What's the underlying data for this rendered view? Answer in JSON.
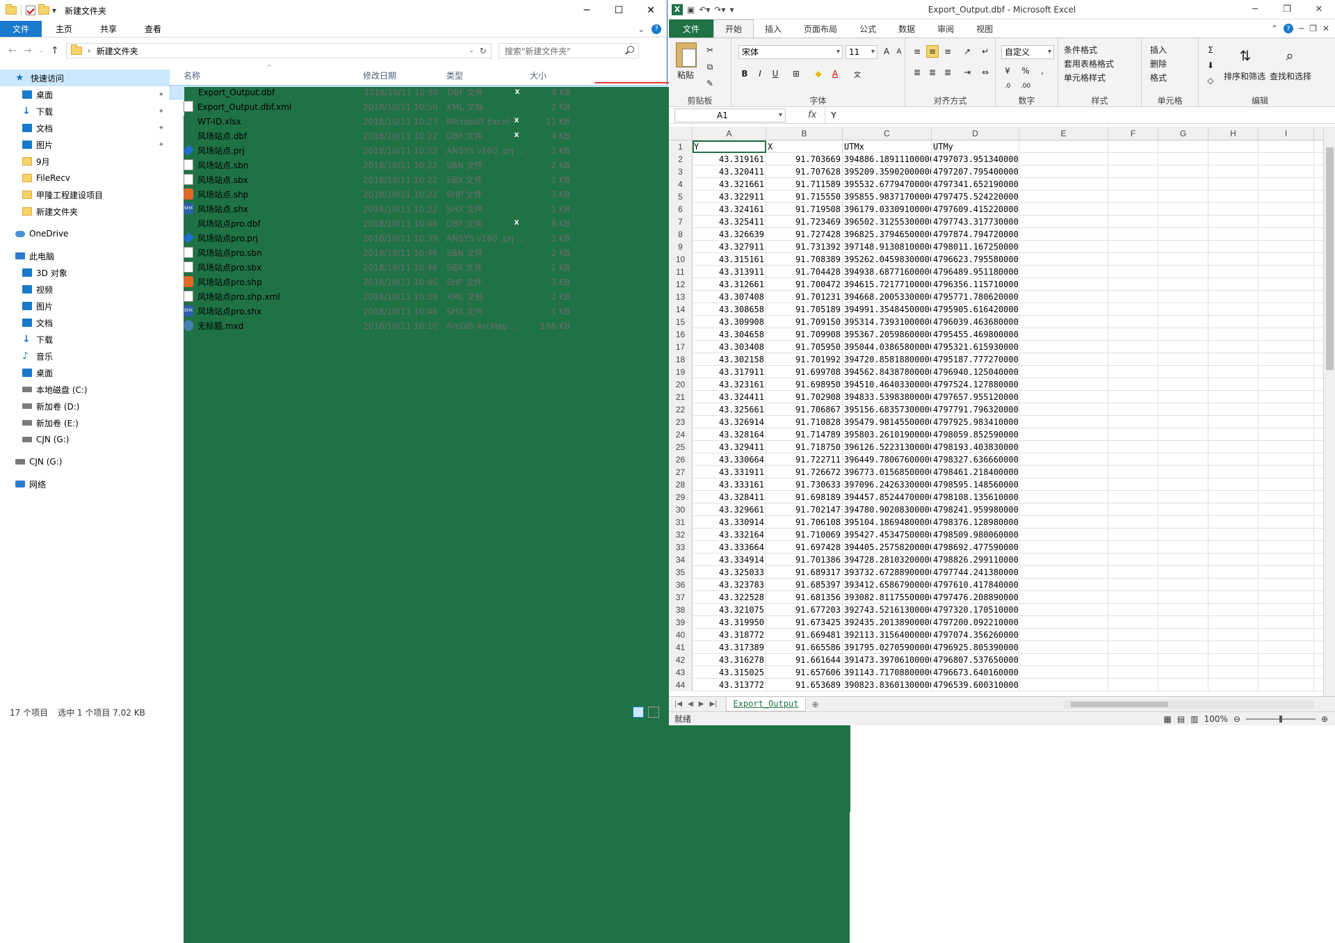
{
  "explorer": {
    "window_title": "新建文件夹",
    "tabs": [
      "文件",
      "主页",
      "共享",
      "查看"
    ],
    "address_path": "新建文件夹",
    "search_placeholder": "搜索\"新建文件夹\"",
    "nav": [
      {
        "label": "快速访问",
        "icon": "star-icon",
        "selected": true,
        "pinned": false
      },
      {
        "label": "桌面",
        "icon": "desktop-icon",
        "pinned": true
      },
      {
        "label": "下载",
        "icon": "download-icon",
        "pinned": true
      },
      {
        "label": "文档",
        "icon": "documents-icon",
        "pinned": true
      },
      {
        "label": "图片",
        "icon": "pictures-icon",
        "pinned": true
      },
      {
        "label": "9月",
        "icon": "folder-icon",
        "pinned": false
      },
      {
        "label": "FileRecv",
        "icon": "folder-icon",
        "pinned": false
      },
      {
        "label": "甲隆工程建设项目",
        "icon": "folder-icon",
        "pinned": false
      },
      {
        "label": "新建文件夹",
        "icon": "folder-icon",
        "pinned": false
      },
      {
        "label": "OneDrive",
        "icon": "cloud-icon",
        "pinned": false
      },
      {
        "label": "此电脑",
        "icon": "computer-icon",
        "pinned": false
      },
      {
        "label": "3D 对象",
        "icon": "3d-objects-icon",
        "pinned": false
      },
      {
        "label": "视频",
        "icon": "video-icon",
        "pinned": false
      },
      {
        "label": "图片",
        "icon": "pictures-icon",
        "pinned": false
      },
      {
        "label": "文档",
        "icon": "documents-icon",
        "pinned": false
      },
      {
        "label": "下载",
        "icon": "download-icon",
        "pinned": false
      },
      {
        "label": "音乐",
        "icon": "music-icon",
        "pinned": false
      },
      {
        "label": "桌面",
        "icon": "desktop-icon",
        "pinned": false
      },
      {
        "label": "本地磁盘 (C:)",
        "icon": "drive-icon",
        "pinned": false
      },
      {
        "label": "新加卷 (D:)",
        "icon": "drive-icon",
        "pinned": false
      },
      {
        "label": "新加卷 (E:)",
        "icon": "drive-icon",
        "pinned": false
      },
      {
        "label": "CJN (G:)",
        "icon": "drive-icon",
        "pinned": false
      },
      {
        "label": "CJN (G:)",
        "icon": "drive-icon",
        "pinned": false
      },
      {
        "label": "网络",
        "icon": "network-icon",
        "pinned": false
      }
    ],
    "columns": {
      "name": "名称",
      "date": "修改日期",
      "type": "类型",
      "size": "大小"
    },
    "files": [
      {
        "name": "Export_Output.dbf",
        "date": "2018/10/11 10:50",
        "type": "DBF 文件",
        "size": "8 KB",
        "icon": "xl",
        "selected": true
      },
      {
        "name": "Export_Output.dbf.xml",
        "date": "2018/10/11 10:50",
        "type": "XML 文档",
        "size": "2 KB",
        "icon": "doc"
      },
      {
        "name": "WT-ID.xlsx",
        "date": "2018/10/11 10:23",
        "type": "Microsoft Excel",
        "size": "11 KB",
        "icon": "xl"
      },
      {
        "name": "风场站点.dbf",
        "date": "2018/10/11 10:22",
        "type": "DBF 文件",
        "size": "4 KB",
        "icon": "xl"
      },
      {
        "name": "风场站点.prj",
        "date": "2018/10/11 10:22",
        "type": "ANSYS v160 .prj ...",
        "size": "1 KB",
        "icon": "prj"
      },
      {
        "name": "风场站点.sbn",
        "date": "2018/10/11 10:22",
        "type": "SBN 文件",
        "size": "2 KB",
        "icon": "doc"
      },
      {
        "name": "风场站点.sbx",
        "date": "2018/10/11 10:22",
        "type": "SBX 文件",
        "size": "1 KB",
        "icon": "doc"
      },
      {
        "name": "风场站点.shp",
        "date": "2018/10/11 10:22",
        "type": "SHP 文件",
        "size": "3 KB",
        "icon": "shp"
      },
      {
        "name": "风场站点.shx",
        "date": "2018/10/11 10:22",
        "type": "SHX 文件",
        "size": "1 KB",
        "icon": "shx"
      },
      {
        "name": "风场站点pro.dbf",
        "date": "2018/10/11 10:46",
        "type": "DBF 文件",
        "size": "8 KB",
        "icon": "xl"
      },
      {
        "name": "风场站点pro.prj",
        "date": "2018/10/11 10:39",
        "type": "ANSYS v160 .prj ...",
        "size": "1 KB",
        "icon": "prj"
      },
      {
        "name": "风场站点pro.sbn",
        "date": "2018/10/11 10:46",
        "type": "SBN 文件",
        "size": "2 KB",
        "icon": "doc"
      },
      {
        "name": "风场站点pro.sbx",
        "date": "2018/10/11 10:46",
        "type": "SBX 文件",
        "size": "1 KB",
        "icon": "doc"
      },
      {
        "name": "风场站点pro.shp",
        "date": "2018/10/11 10:46",
        "type": "SHP 文件",
        "size": "3 KB",
        "icon": "shp"
      },
      {
        "name": "风场站点pro.shp.xml",
        "date": "2018/10/11 10:39",
        "type": "XML 文档",
        "size": "2 KB",
        "icon": "doc"
      },
      {
        "name": "风场站点pro.shx",
        "date": "2018/10/11 10:46",
        "type": "SHX 文件",
        "size": "1 KB",
        "icon": "shx"
      },
      {
        "name": "无标题.mxd",
        "date": "2018/10/11 10:10",
        "type": "ArcGIS ArcMap ...",
        "size": "196 KB",
        "icon": "mxd"
      }
    ],
    "status_count": "17 个项目",
    "status_selected": "选中 1 个项目  7.02 KB"
  },
  "excel": {
    "title": "Export_Output.dbf  -  Microsoft Excel",
    "tabs": [
      "文件",
      "开始",
      "插入",
      "页面布局",
      "公式",
      "数据",
      "审阅",
      "视图"
    ],
    "active_tab": "开始",
    "ribbon": {
      "paste": "粘贴",
      "clipboard": "剪贴板",
      "font_name": "宋体",
      "font_size": "11",
      "font_group": "字体",
      "align_group": "对齐方式",
      "number_format": "自定义",
      "number_group": "数字",
      "cond_format": "条件格式",
      "table_format": "套用表格格式",
      "cell_style": "单元格样式",
      "style_group": "样式",
      "insert": "插入",
      "delete": "删除",
      "format": "格式",
      "cells_group": "单元格",
      "sort_filter": "排序和筛选",
      "find_select": "查找和选择",
      "edit_group": "编辑"
    },
    "namebox": "A1",
    "fx": "fx",
    "formula": "Y",
    "col_letters": [
      "A",
      "B",
      "C",
      "D",
      "E",
      "F",
      "G",
      "H",
      "I"
    ],
    "header_row": [
      "Y",
      "X",
      "UTMx",
      "UTMy"
    ],
    "rows": [
      [
        "43.319161",
        "91.703669",
        "394886.18911100000",
        "4797073.95134000000"
      ],
      [
        "43.320411",
        "91.707628",
        "395209.35902000000",
        "4797207.79540000000"
      ],
      [
        "43.321661",
        "91.711589",
        "395532.67794700000",
        "4797341.65219000000"
      ],
      [
        "43.322911",
        "91.715550",
        "395855.98371700000",
        "4797475.52422000000"
      ],
      [
        "43.324161",
        "91.719508",
        "396179.03309100000",
        "4797609.41522000000"
      ],
      [
        "43.325411",
        "91.723469",
        "396502.31255300000",
        "4797743.31773000000"
      ],
      [
        "43.326639",
        "91.727428",
        "396825.37946500000",
        "4797874.79472000000"
      ],
      [
        "43.327911",
        "91.731392",
        "397148.91308100000",
        "4798011.16725000000"
      ],
      [
        "43.315161",
        "91.708389",
        "395262.04598300000",
        "4796623.79558000000"
      ],
      [
        "43.313911",
        "91.704428",
        "394938.68771600000",
        "4796489.95118000000"
      ],
      [
        "43.312661",
        "91.700472",
        "394615.72177100000",
        "4796356.11571000000"
      ],
      [
        "43.307408",
        "91.701231",
        "394668.20053300000",
        "4795771.78062000000"
      ],
      [
        "43.308658",
        "91.705189",
        "394991.35484500000",
        "4795905.61642000000"
      ],
      [
        "43.309908",
        "91.709150",
        "395314.73931000000",
        "4796039.46368000000"
      ],
      [
        "43.304658",
        "91.709908",
        "395367.20598600000",
        "4795455.46980000000"
      ],
      [
        "43.303408",
        "91.705950",
        "395044.03865800000",
        "4795321.61593000000"
      ],
      [
        "43.302158",
        "91.701992",
        "394720.85818800000",
        "4795187.77727000000"
      ],
      [
        "43.317911",
        "91.699708",
        "394562.84387800000",
        "4796940.12504000000"
      ],
      [
        "43.323161",
        "91.698950",
        "394510.46403300000",
        "4797524.12788000000"
      ],
      [
        "43.324411",
        "91.702908",
        "394833.53983800000",
        "4797657.95512000000"
      ],
      [
        "43.325661",
        "91.706867",
        "395156.68357300000",
        "4797791.79632000000"
      ],
      [
        "43.326914",
        "91.710828",
        "395479.98145500000",
        "4797925.98341000000"
      ],
      [
        "43.328164",
        "91.714789",
        "395803.26101900000",
        "4798059.85259000000"
      ],
      [
        "43.329411",
        "91.718750",
        "396126.52231300000",
        "4798193.40383000000"
      ],
      [
        "43.330664",
        "91.722711",
        "396449.78067600000",
        "4798327.63666000000"
      ],
      [
        "43.331911",
        "91.726672",
        "396773.01568500000",
        "4798461.21840000000"
      ],
      [
        "43.333161",
        "91.730633",
        "397096.24263300000",
        "4798595.14856000000"
      ],
      [
        "43.328411",
        "91.698189",
        "394457.85244700000",
        "4798108.13561000000"
      ],
      [
        "43.329661",
        "91.702147",
        "394780.90208300000",
        "4798241.95998000000"
      ],
      [
        "43.330914",
        "91.706108",
        "395104.18694800000",
        "4798376.12898000000"
      ],
      [
        "43.332164",
        "91.710069",
        "395427.45347500000",
        "4798509.98006000000"
      ],
      [
        "43.333664",
        "91.697428",
        "394405.25758200000",
        "4798692.47759000000"
      ],
      [
        "43.334914",
        "91.701386",
        "394728.28103200000",
        "4798826.29911000000"
      ],
      [
        "43.325033",
        "91.689317",
        "393732.67288900000",
        "4797744.24138000000"
      ],
      [
        "43.323783",
        "91.685397",
        "393412.65867900000",
        "4797610.41784000000"
      ],
      [
        "43.322528",
        "91.681356",
        "393082.81175500000",
        "4797476.20889000000"
      ],
      [
        "43.321075",
        "91.677203",
        "392743.52161300000",
        "4797320.17051000000"
      ],
      [
        "43.319950",
        "91.673425",
        "392435.20138900000",
        "4797200.09221000000"
      ],
      [
        "43.318772",
        "91.669481",
        "392113.31564000000",
        "4797074.35626000000"
      ],
      [
        "43.317389",
        "91.665586",
        "391795.02705900000",
        "4796925.80539000000"
      ],
      [
        "43.316278",
        "91.661644",
        "391473.39706100000",
        "4796807.53765000000"
      ],
      [
        "43.315025",
        "91.657606",
        "391143.71708800000",
        "4796673.64016000000"
      ],
      [
        "43.313772",
        "91.653689",
        "390823.83601300000",
        "4796539.60031000000"
      ]
    ],
    "sheet_name": "Export_Output",
    "status": "就绪",
    "zoom": "100%"
  }
}
